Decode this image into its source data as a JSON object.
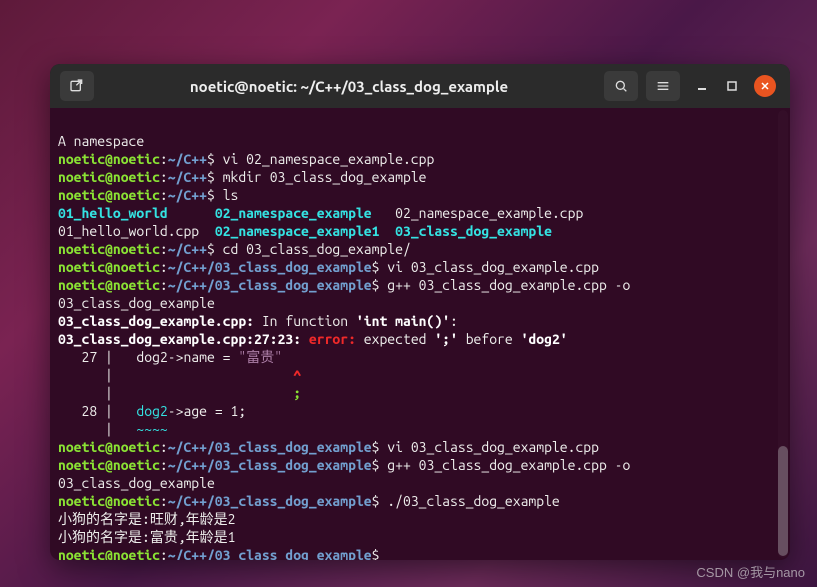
{
  "window": {
    "title": "noetic@noetic: ~/C++/03_class_dog_example"
  },
  "prompt": {
    "user_host": "noetic@noetic",
    "sep": ":",
    "path_cpp": "~/C++",
    "path_ex": "~/C++/03_class_dog_example",
    "dollar": "$"
  },
  "lines": {
    "l0": "A namespace",
    "cmd1": " vi 02_namespace_example.cpp",
    "cmd2": " mkdir 03_class_dog_example",
    "cmd3": " ls",
    "ls_a1": "01_hello_world",
    "ls_a2": "02_namespace_example",
    "ls_a3": "02_namespace_example.cpp",
    "ls_b1": "01_hello_world.cpp",
    "ls_b2": "02_namespace_example1",
    "ls_b3": "03_class_dog_example",
    "cmd4": " cd 03_class_dog_example/",
    "cmd5": " vi 03_class_dog_example.cpp",
    "cmd6": " g++ 03_class_dog_example.cpp -o 03_class_dog_example",
    "err_file": "03_class_dog_example.cpp:",
    "err_infunc": " In function ",
    "err_func": "'int main()'",
    "err_colon": ":",
    "err_loc": "03_class_dog_example.cpp:27:23: ",
    "err_kw": "error:",
    "err_msg1": " expected ",
    "err_tok1": "';'",
    "err_msg2": " before ",
    "err_tok2": "'dog2'",
    "code27n": "   27 |",
    "code27a": "   dog2->name = ",
    "code27s": "\"富贵\"",
    "pipe": "      |",
    "caret": "                       ^",
    "semic": "                       ;",
    "code28n": "   28 |",
    "code28a": "   dog2",
    "code28b": "->age = 1;",
    "tildes": "   ~~~~",
    "cmd7": " vi 03_class_dog_example.cpp",
    "cmd8": " g++ 03_class_dog_example.cpp -o 03_class_dog_example",
    "cmd9": " ./03_class_dog_example",
    "out1": "小狗的名字是:旺财,年龄是2",
    "out2": "小狗的名字是:富贵,年龄是1"
  },
  "watermark": "CSDN @我与nano"
}
